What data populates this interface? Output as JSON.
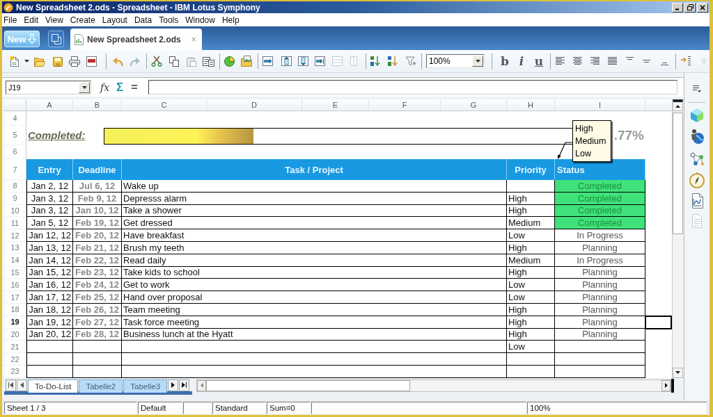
{
  "window": {
    "title": "New Spreadsheet 2.ods - Spreadsheet - IBM Lotus Symphony"
  },
  "menu": [
    "File",
    "Edit",
    "View",
    "Create",
    "Layout",
    "Data",
    "Tools",
    "Window",
    "Help"
  ],
  "document_bar": {
    "new_button": "New",
    "tabs": [
      {
        "label": "New Spreadsheet 2.ods",
        "selected": true,
        "close": "×"
      }
    ]
  },
  "toolbar": {
    "zoom": "100%",
    "bold": "b",
    "italic": "i",
    "underline": "u"
  },
  "formula_bar": {
    "name_box": "J19",
    "function": "fx",
    "sum": "Σ",
    "equals": "="
  },
  "sheet": {
    "columns": [
      "A",
      "B",
      "C",
      "D",
      "E",
      "F",
      "G",
      "H",
      "I"
    ],
    "rows": [
      {
        "number": "4",
        "selected": false,
        "kind": "blank"
      },
      {
        "number": "5",
        "selected": false,
        "kind": "progress",
        "label": "Completed:",
        "level": 0.31,
        "percent": ".77%"
      },
      {
        "number": "6",
        "selected": false,
        "kind": "blank"
      },
      {
        "number": "7",
        "selected": false,
        "kind": "header",
        "cells": [
          "Entry",
          "Deadline",
          "Task / Project",
          "Priority",
          "Status"
        ]
      },
      {
        "number": "8",
        "selected": false,
        "kind": "task",
        "entry": "Jan 2, 12",
        "deadline": "Jul 6, 12",
        "task": "Wake up",
        "status": "Completed",
        "completed": true
      },
      {
        "number": "9",
        "selected": false,
        "kind": "task",
        "entry": "Jan 3, 12",
        "deadline": "Feb 9, 12",
        "task": "Depresss alarm",
        "priority": "High",
        "status": "Completed",
        "completed": true
      },
      {
        "number": "10",
        "selected": false,
        "kind": "task",
        "entry": "Jan 3, 12",
        "deadline": "Jan 10, 12",
        "task": "Take a shower",
        "priority": "High",
        "status": "Completed",
        "completed": true
      },
      {
        "number": "11",
        "selected": false,
        "kind": "task",
        "entry": "Jan 5, 12",
        "deadline": "Feb 19, 12",
        "task": "Get dressed",
        "priority": "Medium",
        "status": "Completed",
        "completed": true
      },
      {
        "number": "12",
        "selected": false,
        "kind": "task",
        "entry": "Jan 12, 12",
        "deadline": "Feb 20, 12",
        "task": "Have breakfast",
        "priority": "Low",
        "status": "In Progress",
        "completed": false
      },
      {
        "number": "13",
        "selected": false,
        "kind": "task",
        "entry": "Jan 13, 12",
        "deadline": "Feb 21, 12",
        "task": "Brush my teeth",
        "priority": "High",
        "status": "Planning",
        "completed": false
      },
      {
        "number": "14",
        "selected": false,
        "kind": "task",
        "entry": "Jan 14, 12",
        "deadline": "Feb 22, 12",
        "task": "Read daily",
        "priority": "Medium",
        "status": "In Progress",
        "completed": false
      },
      {
        "number": "15",
        "selected": false,
        "kind": "task",
        "entry": "Jan 15, 12",
        "deadline": "Feb 23, 12",
        "task": "Take kids to school",
        "priority": "High",
        "status": "Planning",
        "completed": false
      },
      {
        "number": "16",
        "selected": false,
        "kind": "task",
        "entry": "Jan 16, 12",
        "deadline": "Feb 24, 12",
        "task": "Get to work",
        "priority": "Low",
        "status": "Planning",
        "completed": false
      },
      {
        "number": "17",
        "selected": false,
        "kind": "task",
        "entry": "Jan 17, 12",
        "deadline": "Feb 25, 12",
        "task": "Hand over proposal",
        "priority": "Low",
        "status": "Planning",
        "completed": false
      },
      {
        "number": "18",
        "selected": false,
        "kind": "task",
        "entry": "Jan 18, 12",
        "deadline": "Feb 26, 12",
        "task": "Team meeting",
        "priority": "High",
        "status": "Planning",
        "completed": false
      },
      {
        "number": "19",
        "selected": true,
        "kind": "task",
        "entry": "Jan 19, 12",
        "deadline": "Feb 27, 12",
        "task": "Task force meeting",
        "priority": "High",
        "status": "Planning",
        "completed": false
      },
      {
        "number": "20",
        "selected": false,
        "kind": "task",
        "entry": "Jan 20, 12",
        "deadline": "Feb 28, 12",
        "task": "Business lunch at the Hyatt",
        "priority": "High",
        "status": "Planning",
        "completed": false
      },
      {
        "number": "21",
        "selected": false,
        "kind": "task",
        "priority": "Low",
        "completed": false
      },
      {
        "number": "22",
        "selected": false,
        "kind": "task",
        "completed": false
      },
      {
        "number": "23",
        "selected": false,
        "kind": "task",
        "completed": false
      }
    ],
    "validation_list": {
      "options": [
        "High",
        "Medium",
        "Low"
      ]
    }
  },
  "sheet_tabs": [
    {
      "label": "To-Do-List",
      "selected": true
    },
    {
      "label": "Tabelle2",
      "selected": false
    },
    {
      "label": "Tabelle3",
      "selected": false
    }
  ],
  "status_bar": {
    "sheet": "Sheet 1 / 3",
    "page_style": "Default",
    "mode": "Standard",
    "sum": "Sum=0",
    "zoom": "100%"
  }
}
